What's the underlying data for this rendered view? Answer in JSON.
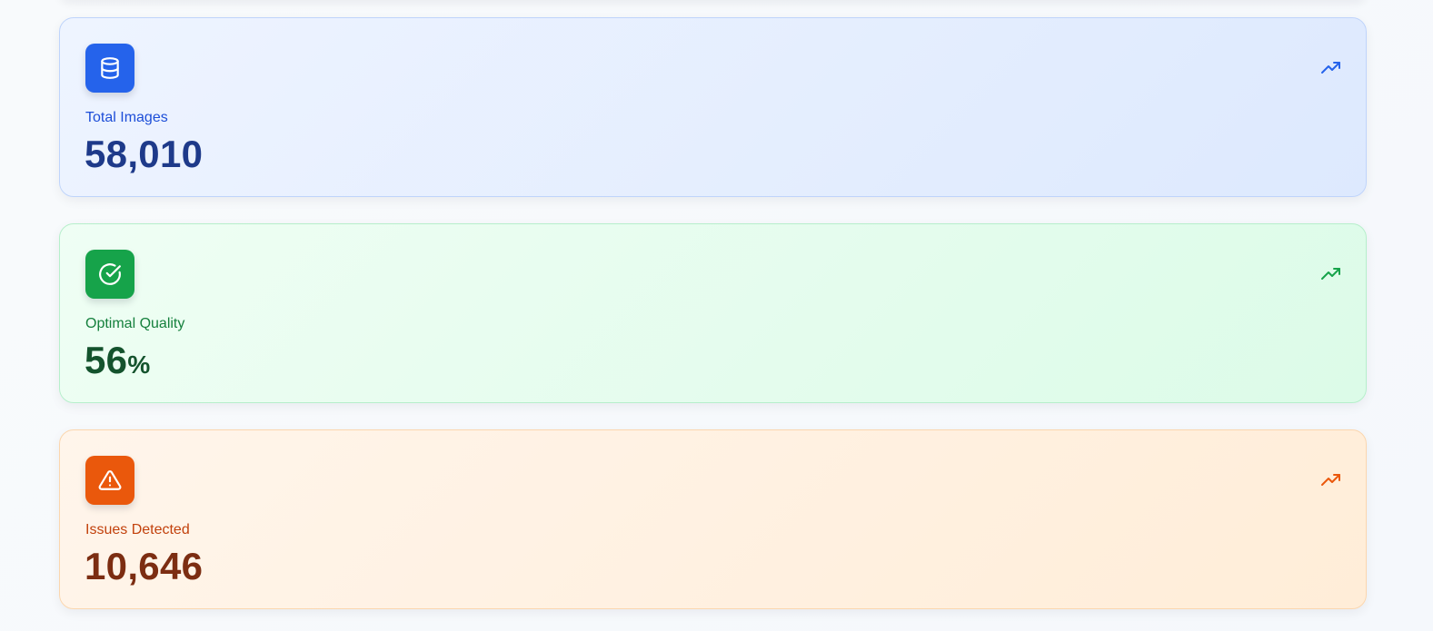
{
  "stats": [
    {
      "label": "Total Images",
      "value": "58,010",
      "unit": "",
      "icon": "database-icon",
      "trend_icon": "trending-up-icon",
      "accent": "#2563eb"
    },
    {
      "label": "Optimal Quality",
      "value": "56",
      "unit": "%",
      "icon": "check-circle-icon",
      "trend_icon": "trending-up-icon",
      "accent": "#16a34a"
    },
    {
      "label": "Issues Detected",
      "value": "10,646",
      "unit": "",
      "icon": "alert-triangle-icon",
      "trend_icon": "trending-up-icon",
      "accent": "#ea580c"
    }
  ]
}
